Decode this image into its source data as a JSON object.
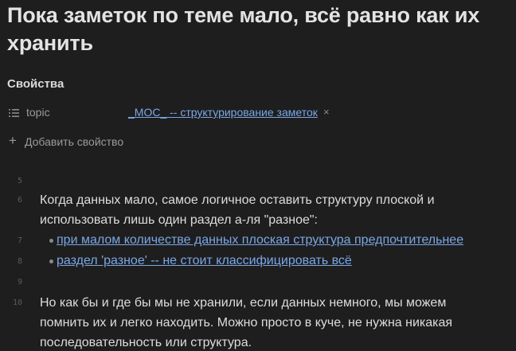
{
  "note": {
    "title": "Пока заметок по теме мало, всё равно как их хранить"
  },
  "properties": {
    "heading": "Свойства",
    "items": [
      {
        "icon": "list-icon",
        "key": "topic",
        "value": "_MOC_ -- структурирование заметок",
        "remove": "×"
      }
    ],
    "add_label": "Добавить свойство",
    "add_icon": "+"
  },
  "lines": {
    "l5": "5",
    "l6": "6",
    "l7": "7",
    "l8": "8",
    "l9": "9",
    "l10": "10"
  },
  "content": {
    "para1": "Когда данных мало, самое логичное оставить структуру плоской и использовать лишь один раздел а-ля \"разное\":",
    "bullets": [
      "при малом количестве данных плоская структура предпочтительнее",
      "раздел 'разное' -- не стоит классифицировать всё"
    ],
    "para2": "Но как бы и где бы мы не хранили, если данных немного, мы можем помнить их и легко находить. Можно просто в куче, не нужна никакая последовательность или структура."
  },
  "colors": {
    "background": "#1e1e1e",
    "text": "#dcddde",
    "link": "#7aa7e6",
    "muted": "#9a9a9a"
  }
}
